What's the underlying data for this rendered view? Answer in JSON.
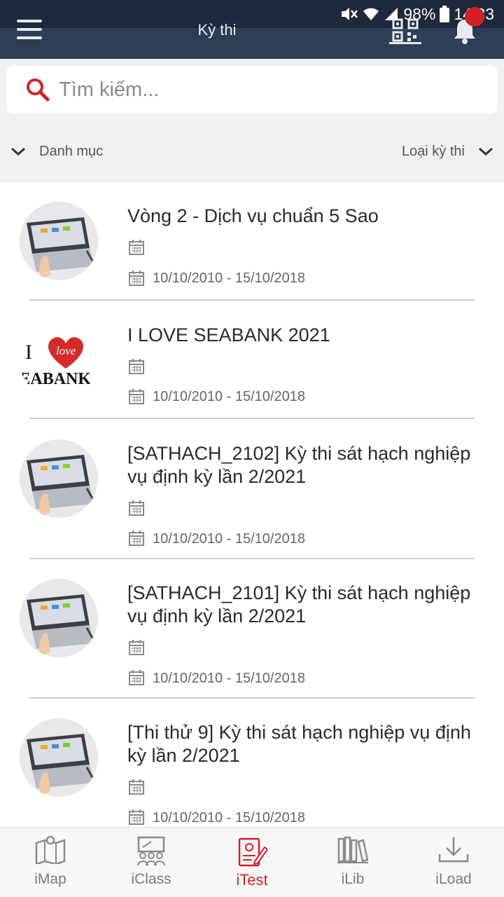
{
  "status_bar": {
    "battery": "98%",
    "time": "14:33"
  },
  "header": {
    "title": "Kỳ thi",
    "notification_count": ""
  },
  "search": {
    "placeholder": "Tìm kiếm..."
  },
  "filters": {
    "category_label": "Danh mục",
    "type_label": "Loại kỳ thi"
  },
  "exams": [
    {
      "title": "Vòng 2 - Dịch vụ chuẩn 5 Sao",
      "date_range": "10/10/2010 - 15/10/2018",
      "thumbnail": "laptop-image"
    },
    {
      "title": " I LOVE SEABANK 2021",
      "date_range": "10/10/2010 - 15/10/2018",
      "thumbnail": "i-love-seabank-logo",
      "logo_text_i": "I",
      "logo_text_love": "love",
      "logo_text_brand": "SEABANK"
    },
    {
      "title": "[SATHACH_2102] Kỳ thi sát hạch nghiệp vụ định kỳ lần 2/2021",
      "date_range": "10/10/2010 - 15/10/2018",
      "thumbnail": "laptop-image"
    },
    {
      "title": "[SATHACH_2101] Kỳ thi sát hạch nghiệp vụ định kỳ lần 2/2021",
      "date_range": "10/10/2010 - 15/10/2018",
      "thumbnail": "laptop-image"
    },
    {
      "title": "[Thi thử 9] Kỳ thi sát hạch nghiệp vụ định kỳ lần 2/2021",
      "date_range": "10/10/2010 - 15/10/2018",
      "thumbnail": "laptop-image"
    }
  ],
  "bottom_nav": [
    {
      "label": "iMap",
      "icon": "map-icon",
      "active": false
    },
    {
      "label": "iClass",
      "icon": "classroom-icon",
      "active": false
    },
    {
      "label": "iTest",
      "icon": "test-icon",
      "active": true
    },
    {
      "label": "iLib",
      "icon": "library-icon",
      "active": false
    },
    {
      "label": "iLoad",
      "icon": "download-icon",
      "active": false
    }
  ],
  "colors": {
    "header": "#2d3e55",
    "status_bar": "#1c2a3b",
    "accent": "#d32028",
    "background": "#f0f1f3"
  }
}
